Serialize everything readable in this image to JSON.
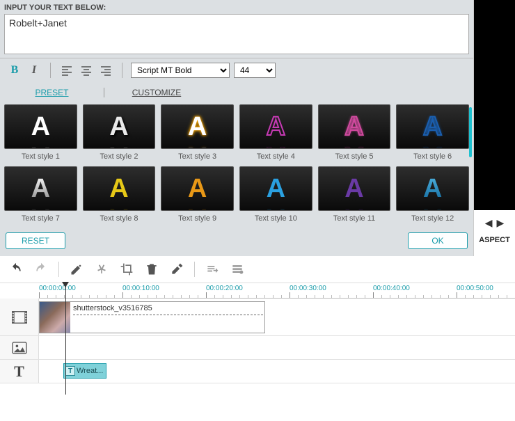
{
  "input": {
    "header": "INPUT YOUR TEXT BELOW:",
    "value": "Robelt+Janet"
  },
  "format": {
    "font_name": "Script MT Bold",
    "font_size": "44"
  },
  "tabs": {
    "preset": "PRESET",
    "customize": "CUSTOMIZE"
  },
  "styles": [
    {
      "label": "Text style 1"
    },
    {
      "label": "Text style 2"
    },
    {
      "label": "Text style 3"
    },
    {
      "label": "Text style 4"
    },
    {
      "label": "Text style 5"
    },
    {
      "label": "Text style 6"
    },
    {
      "label": "Text style 7"
    },
    {
      "label": "Text style 8"
    },
    {
      "label": "Text style 9"
    },
    {
      "label": "Text style 10"
    },
    {
      "label": "Text style 11"
    },
    {
      "label": "Text style 12"
    }
  ],
  "buttons": {
    "reset": "RESET",
    "ok": "OK"
  },
  "preview": {
    "aspect": "ASPECT"
  },
  "timeline": {
    "ticks": [
      "00:00:00:00",
      "00:00:10:00",
      "00:00:20:00",
      "00:00:30:00",
      "00:00:40:00",
      "00:00:50:00"
    ],
    "video_clip": "shutterstock_v3516785",
    "text_clip": "Wreat..."
  }
}
